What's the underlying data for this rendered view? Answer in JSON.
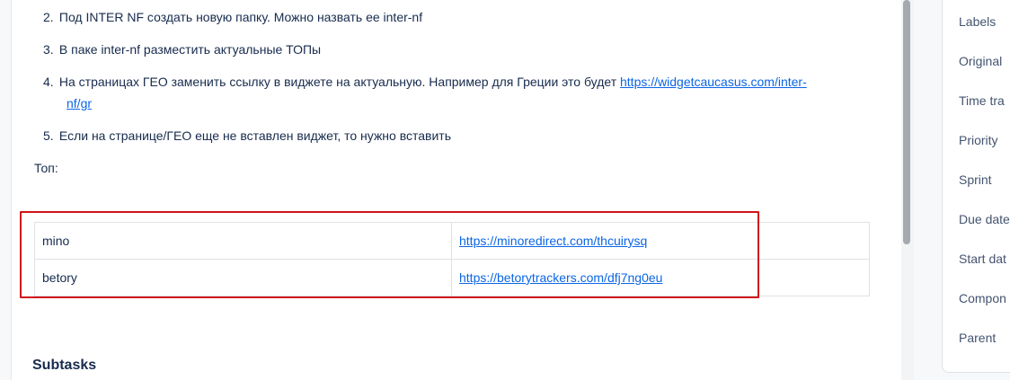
{
  "steps": [
    {
      "number": "2.",
      "text": "Под INTER NF создать новую папку. Можно назвать ее inter-nf"
    },
    {
      "number": "3.",
      "text": "В паке inter-nf разместить актуальные ТОПы"
    },
    {
      "number": "4.",
      "text": "На страницах ГЕО заменить ссылку в виджете на актуальную. Например для Греции это будет ",
      "link_part1": "https://widgetcaucasus.com/inter-",
      "link_part2": "nf/gr"
    },
    {
      "number": "5.",
      "text": "Если на странице/ГЕО еще не вставлен виджет, то нужно вставить"
    }
  ],
  "top_label": "Топ:",
  "tops_table": [
    {
      "name": "mino",
      "url": "https://minoredirect.com/thcuirysq"
    },
    {
      "name": "betory",
      "url": "https://betorytrackers.com/dfj7ng0eu"
    }
  ],
  "subtasks_heading": "Subtasks",
  "details_fields": [
    "Labels",
    "Original",
    "Time tra",
    "Priority",
    "Sprint",
    "Due date",
    "Start dat",
    "Compon",
    "Parent"
  ],
  "colors": {
    "highlight": "#d0141a",
    "link": "#0c66e4"
  }
}
